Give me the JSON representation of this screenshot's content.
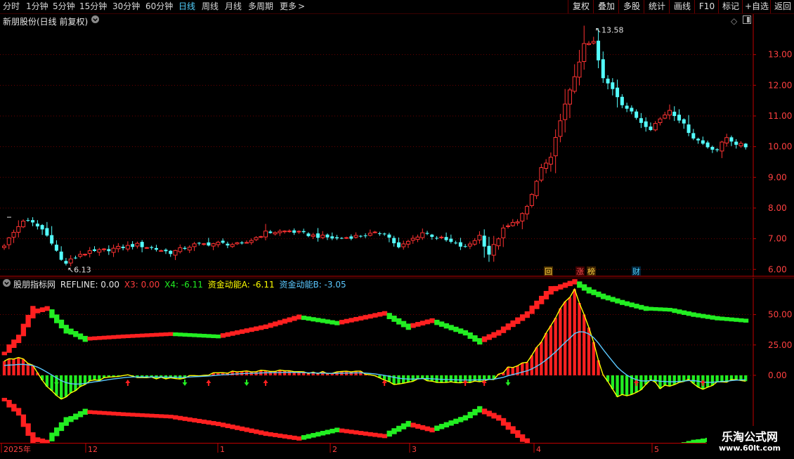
{
  "toolbar": {
    "periods": [
      {
        "label": "分时",
        "active": false
      },
      {
        "label": "1分钟",
        "active": false
      },
      {
        "label": "5分钟",
        "active": false
      },
      {
        "label": "15分钟",
        "active": false
      },
      {
        "label": "30分钟",
        "active": false
      },
      {
        "label": "60分钟",
        "active": false
      },
      {
        "label": "日线",
        "active": true
      },
      {
        "label": "周线",
        "active": false
      },
      {
        "label": "月线",
        "active": false
      },
      {
        "label": "多周期",
        "active": false
      },
      {
        "label": "更多",
        "active": false
      }
    ],
    "more_arrow": ">",
    "buttons": [
      "复权",
      "叠加",
      "多股",
      "统计",
      "画线",
      "F10",
      "标记",
      "+自选",
      "返回"
    ]
  },
  "main": {
    "title": "新朋股份(日线 前复权)",
    "dropdown_icon": "chevron-down-circle",
    "price_axis": [
      "13.00",
      "12.00",
      "11.00",
      "10.00",
      "9.00",
      "8.00",
      "7.00",
      "6.00"
    ],
    "high_label": "13.58",
    "low_label": "6.13",
    "event_markers": [
      {
        "text": "回",
        "color": "#ffd040",
        "bg": "#4a3000"
      },
      {
        "text": "涨",
        "color": "#ff5050",
        "bg": "#3a0000"
      },
      {
        "text": "榜",
        "color": "#ffd040",
        "bg": "#3a2000"
      },
      {
        "text": "财",
        "color": "#52d1ff",
        "bg": "#00243a"
      }
    ]
  },
  "indicator": {
    "name": "股朋指标网",
    "refline_label": "REFLINE: 0.00",
    "x3_label": "X3: 0.00",
    "x4_label": "X4: -6.11",
    "zja_label": "资金动能A: -6.11",
    "zjb_label": "资金动能B: -3.05",
    "axis": [
      "50.00",
      "25.00",
      "0.00"
    ]
  },
  "xaxis": {
    "labels": [
      "2025年",
      "12",
      "1",
      "2",
      "3",
      "4",
      "5"
    ]
  },
  "watermark": {
    "line1": "乐淘公式网",
    "line2": "www.60lt.com"
  },
  "colors": {
    "up": "#ff3232",
    "down": "#54ffff",
    "grid": "#6e0000",
    "axis": "#c00000",
    "yellow": "#ffff00",
    "cyan": "#5bc8ff",
    "green": "#22ee22",
    "red": "#ff2020"
  },
  "chart_data": {
    "type": "candlestick",
    "price_range": [
      5.8,
      14.0
    ],
    "n_bars": 157,
    "high": 13.58,
    "low": 6.13,
    "anchors": [
      [
        0,
        6.8
      ],
      [
        2,
        7.2
      ],
      [
        4,
        7.6
      ],
      [
        6,
        7.5
      ],
      [
        8,
        7.3
      ],
      [
        10,
        6.9
      ],
      [
        12,
        6.3
      ],
      [
        13,
        6.2
      ],
      [
        16,
        6.5
      ],
      [
        20,
        6.6
      ],
      [
        28,
        6.8
      ],
      [
        35,
        6.55
      ],
      [
        40,
        6.8
      ],
      [
        45,
        6.85
      ],
      [
        50,
        6.8
      ],
      [
        55,
        7.2
      ],
      [
        60,
        7.25
      ],
      [
        65,
        7.1
      ],
      [
        70,
        7.0
      ],
      [
        75,
        7.1
      ],
      [
        80,
        7.2
      ],
      [
        83,
        6.7
      ],
      [
        88,
        7.2
      ],
      [
        92,
        7.0
      ],
      [
        97,
        6.7
      ],
      [
        100,
        7.1
      ],
      [
        102,
        6.5
      ],
      [
        105,
        7.3
      ],
      [
        108,
        7.6
      ],
      [
        110,
        8.0
      ],
      [
        113,
        9.3
      ],
      [
        115,
        9.6
      ],
      [
        117,
        10.9
      ],
      [
        119,
        11.8
      ],
      [
        122,
        13.3
      ],
      [
        124,
        13.4
      ],
      [
        126,
        12.2
      ],
      [
        128,
        11.9
      ],
      [
        130,
        11.4
      ],
      [
        134,
        10.8
      ],
      [
        136,
        10.6
      ],
      [
        140,
        11.2
      ],
      [
        142,
        10.9
      ],
      [
        145,
        10.3
      ],
      [
        148,
        10.0
      ],
      [
        150,
        9.9
      ],
      [
        152,
        10.3
      ],
      [
        154,
        10.1
      ],
      [
        156,
        10.0
      ]
    ],
    "indicator_range": [
      -55,
      70
    ],
    "x3_anchors": [
      [
        0,
        12
      ],
      [
        3,
        15
      ],
      [
        6,
        8
      ],
      [
        9,
        -10
      ],
      [
        12,
        -20
      ],
      [
        18,
        -5
      ],
      [
        25,
        0
      ],
      [
        35,
        -3
      ],
      [
        45,
        2
      ],
      [
        55,
        4
      ],
      [
        65,
        2
      ],
      [
        75,
        3
      ],
      [
        83,
        -8
      ],
      [
        88,
        -3
      ],
      [
        92,
        -6
      ],
      [
        97,
        -5
      ],
      [
        100,
        -6
      ],
      [
        103,
        -3
      ],
      [
        106,
        6
      ],
      [
        110,
        11
      ],
      [
        113,
        28
      ],
      [
        117,
        55
      ],
      [
        120,
        70
      ],
      [
        123,
        40
      ],
      [
        126,
        0
      ],
      [
        129,
        -17
      ],
      [
        133,
        -15
      ],
      [
        136,
        -3
      ],
      [
        138,
        -10
      ],
      [
        141,
        -7
      ],
      [
        144,
        -4
      ],
      [
        147,
        -12
      ],
      [
        150,
        -6
      ],
      [
        153,
        -4
      ],
      [
        156,
        -5
      ]
    ],
    "upper_anchors": [
      [
        0,
        18
      ],
      [
        3,
        30
      ],
      [
        6,
        52
      ],
      [
        9,
        55
      ],
      [
        13,
        38
      ],
      [
        17,
        30
      ],
      [
        25,
        32
      ],
      [
        35,
        34
      ],
      [
        45,
        32
      ],
      [
        55,
        40
      ],
      [
        62,
        48
      ],
      [
        70,
        43
      ],
      [
        80,
        51
      ],
      [
        85,
        40
      ],
      [
        90,
        45
      ],
      [
        97,
        35
      ],
      [
        100,
        28
      ],
      [
        104,
        35
      ],
      [
        110,
        50
      ],
      [
        115,
        70
      ],
      [
        120,
        77
      ],
      [
        123,
        70
      ],
      [
        126,
        65
      ],
      [
        130,
        60
      ],
      [
        135,
        55
      ],
      [
        140,
        54
      ],
      [
        145,
        50
      ],
      [
        150,
        47
      ],
      [
        156,
        45
      ]
    ],
    "lower_anchors": [
      [
        0,
        -20
      ],
      [
        3,
        -30
      ],
      [
        6,
        -52
      ],
      [
        9,
        -55
      ],
      [
        13,
        -38
      ],
      [
        17,
        -30
      ],
      [
        25,
        -32
      ],
      [
        35,
        -34
      ],
      [
        45,
        -40
      ],
      [
        55,
        -48
      ],
      [
        62,
        -52
      ],
      [
        70,
        -45
      ],
      [
        80,
        -50
      ],
      [
        85,
        -40
      ],
      [
        90,
        -45
      ],
      [
        97,
        -35
      ],
      [
        100,
        -28
      ],
      [
        104,
        -35
      ],
      [
        110,
        -55
      ],
      [
        115,
        -75
      ],
      [
        120,
        -82
      ],
      [
        123,
        -80
      ],
      [
        126,
        -75
      ],
      [
        130,
        -70
      ],
      [
        135,
        -62
      ],
      [
        140,
        -60
      ],
      [
        145,
        -55
      ],
      [
        150,
        -52
      ],
      [
        156,
        -48
      ]
    ],
    "down_arrows": [
      11,
      38,
      51,
      106
    ],
    "up_arrows": [
      26,
      43,
      55,
      80,
      97,
      101,
      133,
      147
    ],
    "main_up_label_idx": 124,
    "main_low_label_idx": 13
  }
}
